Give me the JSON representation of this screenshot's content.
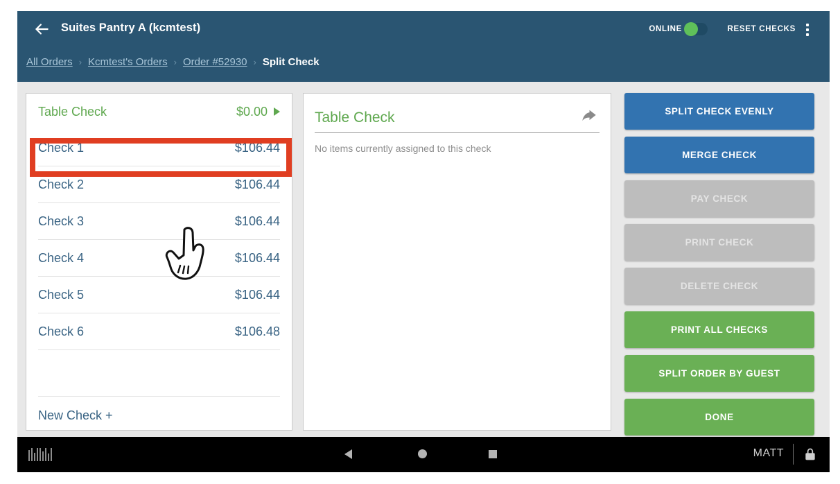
{
  "header": {
    "back_icon": "back-arrow-icon",
    "title": "Suites Pantry A (kcmtest)",
    "online_label": "ONLINE",
    "online_state": "on",
    "reset_label": "RESET CHECKS",
    "overflow_icon": "kebab-menu-icon",
    "bg_color": "#2a5572",
    "toggle_on_color": "#5fc05a"
  },
  "breadcrumb": {
    "items": [
      {
        "label": "All Orders",
        "current": false
      },
      {
        "label": "Kcmtest's Orders",
        "current": false
      },
      {
        "label": "Order #52930",
        "current": false
      },
      {
        "label": "Split Check",
        "current": true
      }
    ],
    "separator": "›"
  },
  "check_list": {
    "table_check": {
      "name": "Table Check",
      "amount": "$0.00",
      "chevron": "▶"
    },
    "rows": [
      {
        "name": "Check 1",
        "amount": "$106.44",
        "selected": true
      },
      {
        "name": "Check 2",
        "amount": "$106.44",
        "selected": false
      },
      {
        "name": "Check 3",
        "amount": "$106.44",
        "selected": false
      },
      {
        "name": "Check 4",
        "amount": "$106.44",
        "selected": false
      },
      {
        "name": "Check 5",
        "amount": "$106.44",
        "selected": false
      },
      {
        "name": "Check 6",
        "amount": "$106.48",
        "selected": false
      }
    ],
    "new_check_label": "New Check +",
    "highlight_color": "#e03e21",
    "text_color": "#3a6484",
    "table_check_color": "#5fa84f"
  },
  "detail_panel": {
    "title": "Table Check",
    "share_icon": "share-arrow-icon",
    "empty_message": "No items currently assigned to this check",
    "title_color": "#5fa84f"
  },
  "actions": {
    "buttons": [
      {
        "label": "SPLIT CHECK EVENLY",
        "style": "blue",
        "enabled": true
      },
      {
        "label": "MERGE CHECK",
        "style": "blue",
        "enabled": true
      },
      {
        "label": "PAY CHECK",
        "style": "gray",
        "enabled": false
      },
      {
        "label": "PRINT CHECK",
        "style": "gray",
        "enabled": false
      },
      {
        "label": "DELETE CHECK",
        "style": "gray",
        "enabled": false
      },
      {
        "label": "PRINT ALL CHECKS",
        "style": "green",
        "enabled": true
      },
      {
        "label": "SPLIT ORDER BY GUEST",
        "style": "green",
        "enabled": true
      },
      {
        "label": "DONE",
        "style": "green",
        "enabled": true
      }
    ],
    "blue_color": "#3273b0",
    "green_color": "#6ab055",
    "gray_color": "#bdbdbd"
  },
  "navbar": {
    "keyboard_icon": "barcode-icon",
    "back_icon": "nav-back-triangle-icon",
    "home_icon": "nav-home-circle-icon",
    "recents_icon": "nav-recents-square-icon",
    "user": "MATT",
    "lock_icon": "lock-icon"
  }
}
